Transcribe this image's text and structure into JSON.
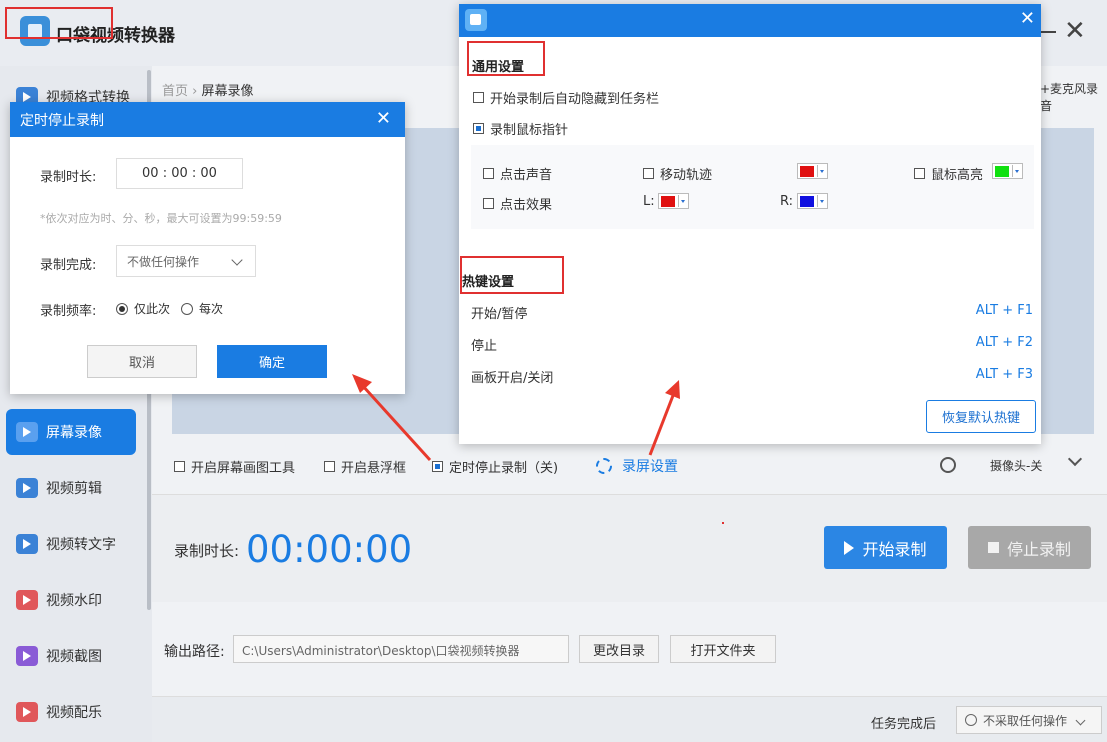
{
  "app": {
    "title": "口袋视频转换器"
  },
  "sidebar": {
    "items": [
      {
        "label": "视频格式转换",
        "color": "blue"
      },
      {
        "label": "屏幕录像",
        "color": "blue",
        "active": true
      },
      {
        "label": "视频剪辑",
        "color": "blue"
      },
      {
        "label": "视频转文字",
        "color": "blue"
      },
      {
        "label": "视频水印",
        "color": "red"
      },
      {
        "label": "视频截图",
        "color": "purple"
      },
      {
        "label": "视频配乐",
        "color": "red"
      }
    ]
  },
  "breadcrumb": {
    "home": "首页",
    "separator": "›",
    "current": "屏幕录像"
  },
  "mic_label": "+麦克风录音",
  "toolbar": {
    "draw_tool": "开启屏幕画图工具",
    "float_box": "开启悬浮框",
    "timed_stop": "定时停止录制（关)",
    "settings": "录屏设置",
    "camera": "摄像头-关"
  },
  "recording": {
    "duration_label": "录制时长:",
    "duration_value": "00:00:00",
    "start": "开始录制",
    "stop": "停止录制"
  },
  "output": {
    "label": "输出路径:",
    "path": "C:\\Users\\Administrator\\Desktop\\口袋视频转换器",
    "change_dir": "更改目录",
    "open_folder": "打开文件夹"
  },
  "footer": {
    "task_label": "任务完成后",
    "task_value": "不采取任何操作"
  },
  "timer_dialog": {
    "title": "定时停止录制",
    "duration_label": "录制时长:",
    "duration_value": "00 : 00 : 00",
    "hint": "*依次对应为时、分、秒，最大可设置为99:59:59",
    "done_label": "录制完成:",
    "done_value": "不做任何操作",
    "freq_label": "录制频率:",
    "freq_once": "仅此次",
    "freq_every": "每次",
    "cancel": "取消",
    "ok": "确定"
  },
  "settings_dialog": {
    "general_title": "通用设置",
    "auto_hide": "开始录制后自动隐藏到任务栏",
    "record_cursor": "录制鼠标指针",
    "click_sound": "点击声音",
    "move_track": "移动轨迹",
    "cursor_highlight": "鼠标高亮",
    "click_effect": "点击效果",
    "left_label": "L:",
    "right_label": "R:",
    "hotkey_title": "热键设置",
    "hotkeys": [
      {
        "action": "开始/暂停",
        "key": "ALT + F1"
      },
      {
        "action": "停止",
        "key": "ALT + F2"
      },
      {
        "action": "画板开启/关闭",
        "key": "ALT + F3"
      }
    ],
    "restore": "恢复默认热键",
    "colors": {
      "move_track": "#e01010",
      "highlight": "#10e010",
      "left": "#e01010",
      "right": "#1010e0"
    }
  },
  "accent_color": "#1a7ce2"
}
